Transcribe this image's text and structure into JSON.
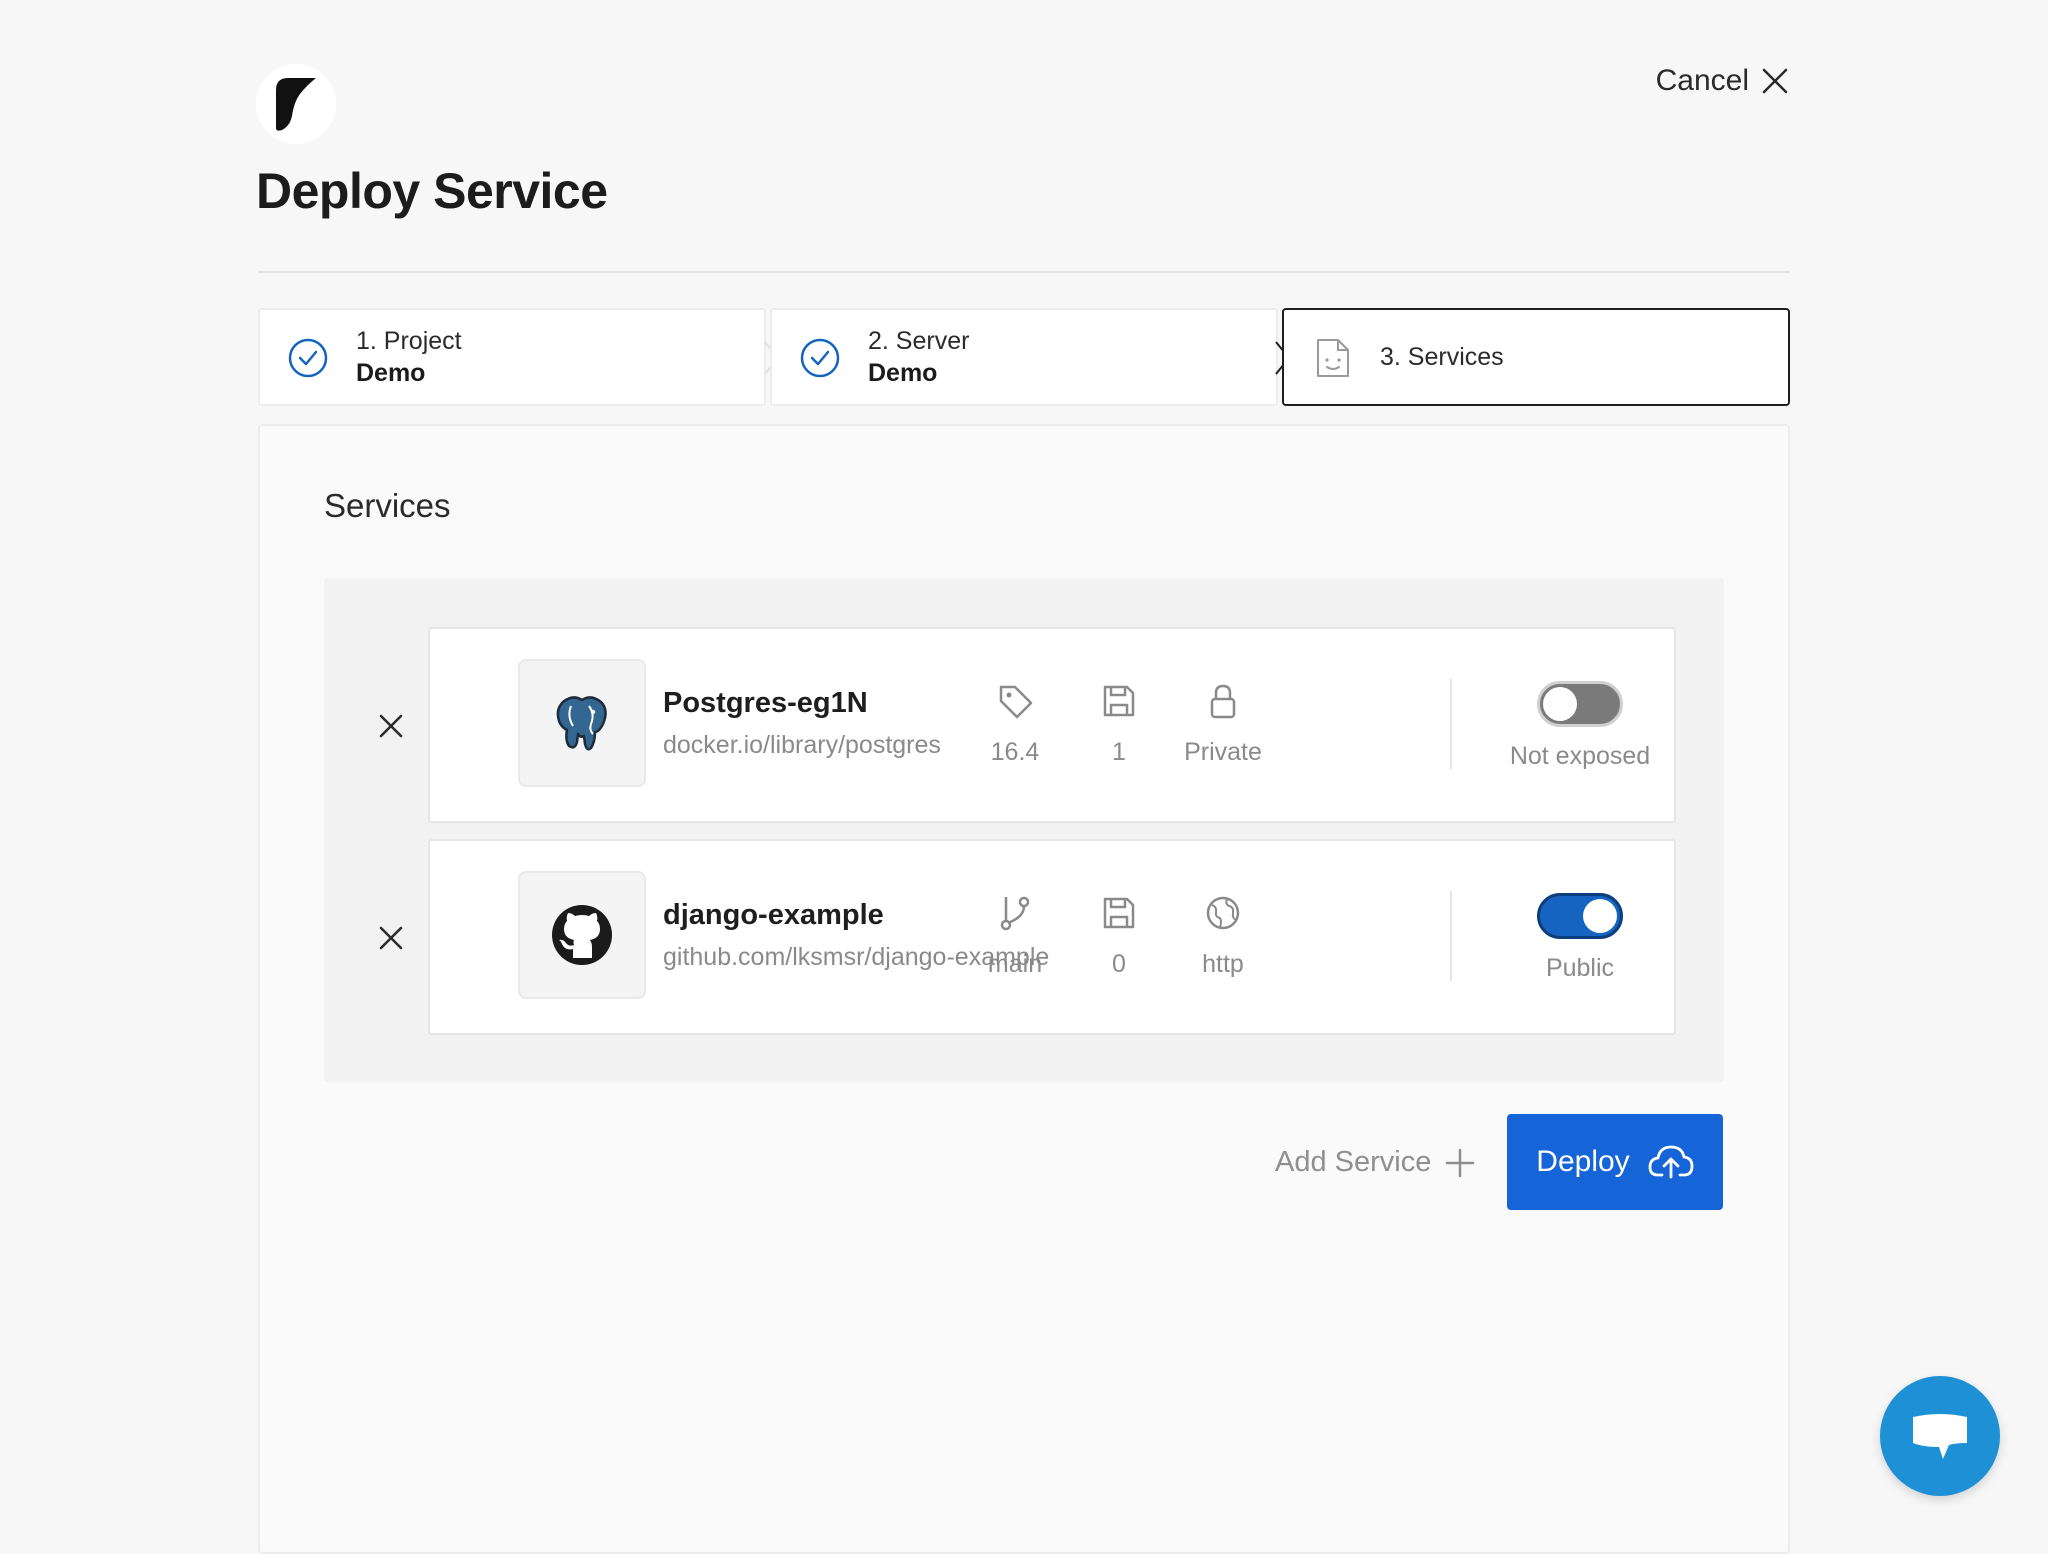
{
  "header": {
    "title": "Deploy Service",
    "cancel_label": "Cancel"
  },
  "steps": [
    {
      "label": "1. Project",
      "value": "Demo",
      "status": "complete"
    },
    {
      "label": "2. Server",
      "value": "Demo",
      "status": "complete"
    },
    {
      "label": "3. Services",
      "value": "",
      "status": "active"
    }
  ],
  "section_title": "Services",
  "services": [
    {
      "name": "Postgres-eg1N",
      "source": "docker.io/library/postgres",
      "icon": "postgres-elephant-icon",
      "meta": [
        {
          "icon": "tag-icon",
          "value": "16.4"
        },
        {
          "icon": "floppy-disk-icon",
          "value": "1"
        },
        {
          "icon": "lock-icon",
          "value": "Private"
        }
      ],
      "exposure": {
        "label": "Not exposed",
        "enabled": false
      }
    },
    {
      "name": "django-example",
      "source": "github.com/lksmsr/django-example",
      "icon": "github-icon",
      "meta": [
        {
          "icon": "git-branch-icon",
          "value": "main"
        },
        {
          "icon": "floppy-disk-icon",
          "value": "0"
        },
        {
          "icon": "globe-icon",
          "value": "http"
        }
      ],
      "exposure": {
        "label": "Public",
        "enabled": true
      }
    }
  ],
  "actions": {
    "add_service_label": "Add Service",
    "deploy_label": "Deploy"
  },
  "colors": {
    "accent": "#1565d8",
    "toggle_on": "#1565c0",
    "chat_fab": "#1e90d6",
    "check": "#1565c0"
  }
}
